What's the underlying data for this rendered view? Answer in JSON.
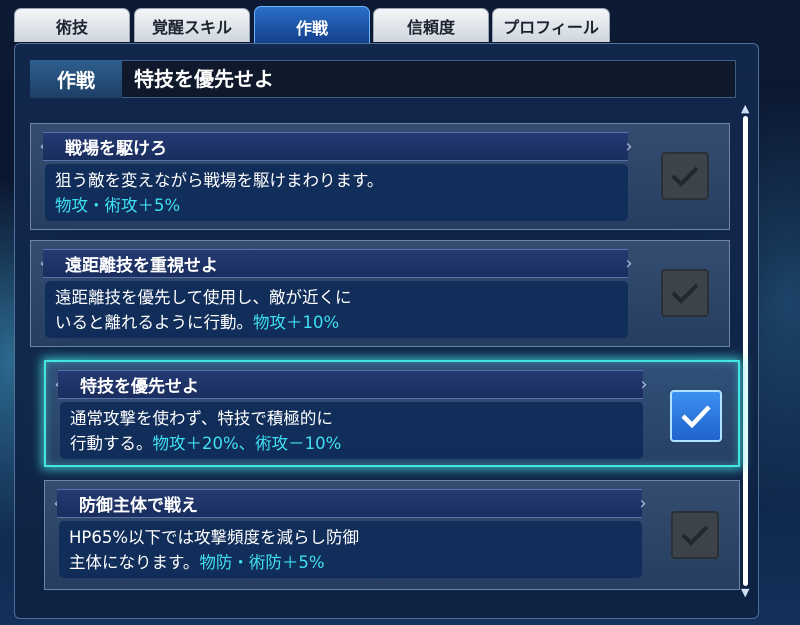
{
  "tabs": [
    {
      "label": "術技",
      "active": false
    },
    {
      "label": "覚醒スキル",
      "active": false
    },
    {
      "label": "作戦",
      "active": true
    },
    {
      "label": "信頼度",
      "active": false
    },
    {
      "label": "プロフィール",
      "active": false
    }
  ],
  "header": {
    "label": "作戦",
    "value": "特技を優先せよ"
  },
  "strategies": [
    {
      "title": "戦場を駆けろ",
      "desc_line1": "狙う敵を変えながら戦場を駆けまわります。",
      "desc_line2": "",
      "effect": "物攻・術攻＋5%",
      "checked": true,
      "selected": false
    },
    {
      "title": "遠距離技を重視せよ",
      "desc_line1": "遠距離技を優先して使用し、敵が近くに",
      "desc_line2": "いると離れるように行動。",
      "effect": "物攻＋10%",
      "checked": true,
      "selected": false
    },
    {
      "title": "特技を優先せよ",
      "desc_line1": "通常攻撃を使わず、特技で積極的に",
      "desc_line2": "行動する。",
      "effect": "物攻＋20%、術攻－10%",
      "checked": true,
      "selected": true
    },
    {
      "title": "防御主体で戦え",
      "desc_line1": "HP65%以下では攻撃頻度を減らし防御",
      "desc_line2": "主体になります。",
      "effect": "物防・術防＋5%",
      "checked": true,
      "selected": false
    }
  ],
  "colors": {
    "effect_text": "#3ee0f2",
    "selected_glow": "#43e5e0",
    "active_tab": "#2a6fc9",
    "check_on": "#3d8ff0",
    "check_off": "#3c434b"
  },
  "icons": {
    "checkbox": "checkmark-icon",
    "ribbon_end": "diamond-chevron-icon",
    "scroll": "scroll-arrow-icon"
  }
}
